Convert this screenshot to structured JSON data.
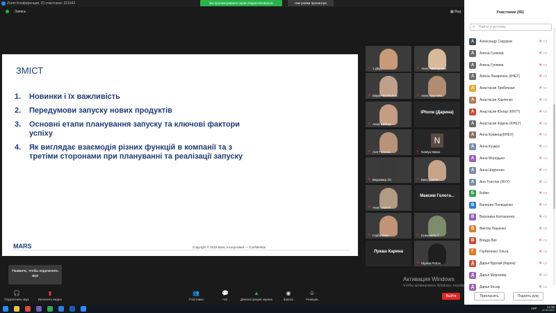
{
  "window": {
    "title": "Zoom Конференция, ID участника: 221042",
    "share_notice": "Вы просматриваете экран Мария Всеволож",
    "view_options": "Настройки просмотра",
    "recording": "Запись",
    "view_label": "Вид"
  },
  "slide": {
    "title": "ЗМІСТ",
    "items": [
      {
        "num": "1.",
        "text": "Новинки і їх важливість"
      },
      {
        "num": "2.",
        "text": "Передумови запуску нових продуктів"
      },
      {
        "num": "3.",
        "text": "Основні етапи планування запуску та ключові фактори успіху"
      },
      {
        "num": "4.",
        "text": "Як виглядає взаємодія різних функцій в компанії та з третіми сторонами при плануванні та реалізації запуску"
      }
    ],
    "logo": "MARS",
    "copyright": "Copyright © 2019 Mars, Incorporated — Confidential"
  },
  "gallery": [
    {
      "name": "1 ДБД",
      "kind": "video",
      "skin": "#c99a78"
    },
    {
      "name": "Анна Хвастунова",
      "kind": "video",
      "skin": "#d7b99c"
    },
    {
      "name": "Мария Всеволож",
      "kind": "video",
      "skin": "#bfa08a"
    },
    {
      "name": "Анна Крылова",
      "kind": "video",
      "skin": "#b08c70"
    },
    {
      "name": "Анна Шевчук",
      "kind": "video",
      "skin": "#c49d84"
    },
    {
      "name": "iPhone (Дарина)",
      "kind": "text"
    },
    {
      "name": "Аня Толстых",
      "kind": "video",
      "skin": "#b8937a"
    },
    {
      "name": "Nastya Matve",
      "kind": "letter",
      "letter": "N"
    },
    {
      "name": "Вероника Ab",
      "kind": "video",
      "skin": "#3a3a3a"
    },
    {
      "name": "Виктория Ж",
      "kind": "video",
      "skin": "#c7a38a"
    },
    {
      "name": "Анастасия К",
      "kind": "video",
      "skin": "#b39a84"
    },
    {
      "name": "Максим Голота...",
      "kind": "text"
    },
    {
      "name": "Горбатенко",
      "kind": "video",
      "skin": "#c19478"
    },
    {
      "name": "Елизавета Т",
      "kind": "video",
      "skin": "#7d8c6a"
    },
    {
      "name": "Лукаш Карина",
      "kind": "text"
    },
    {
      "name": "Ulyana Petrov",
      "kind": "video",
      "skin": "#1f1f1f"
    }
  ],
  "notice": "Нажмите, чтобы подключить звук",
  "toolbar": {
    "audio": "Подключить звук",
    "video": "Включить видео",
    "participants": "Участники",
    "participants_count": "55",
    "chat": "Чат",
    "share": "Демонстрация экрана",
    "record": "Запись",
    "reactions": "Реакции",
    "leave": "Выйти"
  },
  "watermark": {
    "line1": "Активация Windows",
    "line2": "Чтобы активировать Windows, перейдите в раздел \"Параметры\"."
  },
  "panel": {
    "title": "Участники (55)",
    "search_placeholder": "Найти участника",
    "participants": [
      {
        "initial": "А",
        "name": "Александр Сидоров",
        "color": "#444c55"
      },
      {
        "initial": "А",
        "name": "Алена Гуляева",
        "color": "#6b6b6b"
      },
      {
        "initial": "А",
        "name": "Алена Гуляева",
        "color": "#6b6b6b"
      },
      {
        "initial": "А",
        "name": "Алёна Лазаренко (КНЕУ)",
        "color": "#6b6b6b"
      },
      {
        "initial": "А",
        "name": "Анастасия Трибечная",
        "color": "#e8a93b"
      },
      {
        "initial": "А",
        "name": "Анастасия Харченко",
        "color": "#b07a5a"
      },
      {
        "initial": "А",
        "name": "Анастасия Юнгар (КНУТ)",
        "color": "#c94c38"
      },
      {
        "initial": "А",
        "name": "Анастасия Фідель (КНЕУ)",
        "color": "#6b6b6b"
      },
      {
        "initial": "А",
        "name": "Анна Кравець(КНЕУ)",
        "color": "#8a6e5c"
      },
      {
        "initial": "А",
        "name": "Анна Кузмук",
        "color": "#7f8ea8"
      },
      {
        "initial": "А",
        "name": "Анна Молодько",
        "color": "#9b5fb8"
      },
      {
        "initial": "А",
        "name": "Анна Шкуренко",
        "color": "#7f8ea8"
      },
      {
        "initial": "А",
        "name": "Аня Толстих (НУУ)",
        "color": "#7f8ea8"
      },
      {
        "initial": "Б",
        "name": "Бойко",
        "color": "#36a351"
      },
      {
        "initial": "В",
        "name": "Валерия Полищенко",
        "color": "#2d7dd2"
      },
      {
        "initial": "В",
        "name": "Вероника Колтаненко",
        "color": "#9b5fb8"
      },
      {
        "initial": "В",
        "name": "Виктор Лешенко",
        "color": "#e07a2b"
      },
      {
        "initial": "В",
        "name": "Влада Лих",
        "color": "#c94c38"
      },
      {
        "initial": "Г",
        "name": "Горбатенко Ольга",
        "color": "#e07a2b"
      },
      {
        "initial": "Д",
        "name": "Дарья Бурлай (Кирюк)",
        "color": "#c94c38"
      },
      {
        "initial": "Д",
        "name": "Дарья Морозова",
        "color": "#9b5fb8"
      },
      {
        "initial": "Д",
        "name": "Дарья Косар",
        "color": "#9b5fb8"
      }
    ],
    "invite": "Пригласить",
    "raise_hand": "Поднять руку"
  },
  "taskbar": {
    "lang": "УКР",
    "time": "14:38",
    "date": "22.04.2021"
  }
}
